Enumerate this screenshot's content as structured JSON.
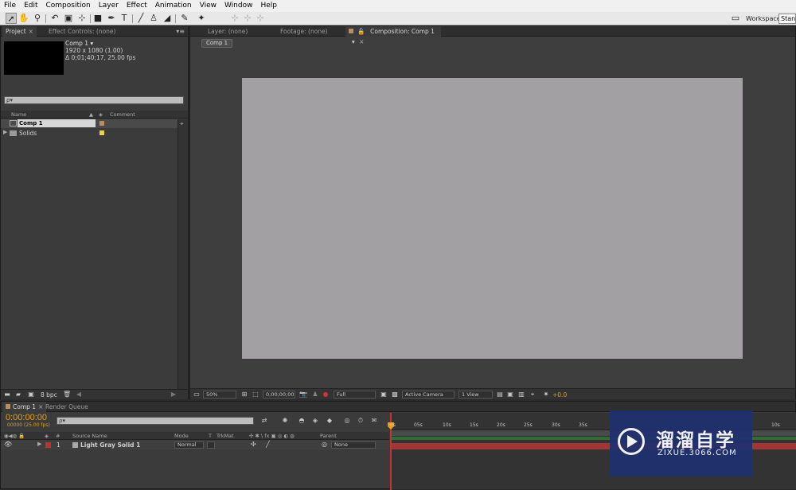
{
  "menu": [
    "File",
    "Edit",
    "Composition",
    "Layer",
    "Effect",
    "Animation",
    "View",
    "Window",
    "Help"
  ],
  "workspace": {
    "label": "Workspace:",
    "value": "Stand"
  },
  "project_panel": {
    "tabs": [
      "Project",
      "Effect Controls: (none)"
    ],
    "comp_name": "Comp 1 ▾",
    "comp_res": "1920 x 1080 (1.00)",
    "comp_dur": "Δ 0;01;40;17, 25.00 fps",
    "search_placeholder": "ρ▾",
    "columns": {
      "name": "Name",
      "comment": "Comment"
    },
    "items": [
      {
        "name": "Comp 1",
        "label_color": "#b89060"
      },
      {
        "name": "Solids",
        "label_color": "#e8d24a"
      }
    ],
    "bpc": "8 bpc"
  },
  "viewer": {
    "tabs": [
      "Layer: (none)",
      "Footage: (none)",
      "Composition: Comp 1"
    ],
    "comp_button": "Comp 1",
    "zoom": "50%",
    "timecode": "0;00;00;00",
    "resolution": "Full",
    "camera": "Active Camera",
    "views": "1 View",
    "exposure": "+0.0",
    "canvas_color": "#a2a0a3"
  },
  "timeline": {
    "tabs": [
      "Comp 1",
      "Render Queue"
    ],
    "timecode": "0:00:00:00",
    "fps": "00000 (25.00 fps)",
    "search_placeholder": "ρ▾",
    "headers": {
      "source": "Source Name",
      "mode": "Mode",
      "t": "T",
      "trkmat": "TrkMat",
      "parent": "Parent",
      "num": "#"
    },
    "layer": {
      "num": "1",
      "name": "Light Gray Solid 1",
      "mode": "Normal",
      "parent": "None",
      "label_color": "#c03030"
    },
    "ruler": [
      "0s",
      "05s",
      "10s",
      "15s",
      "20s",
      "25s",
      "30s",
      "35s",
      "10s"
    ]
  },
  "watermark": {
    "title": "溜溜自学",
    "url": "ZIXUE.3066.COM"
  }
}
